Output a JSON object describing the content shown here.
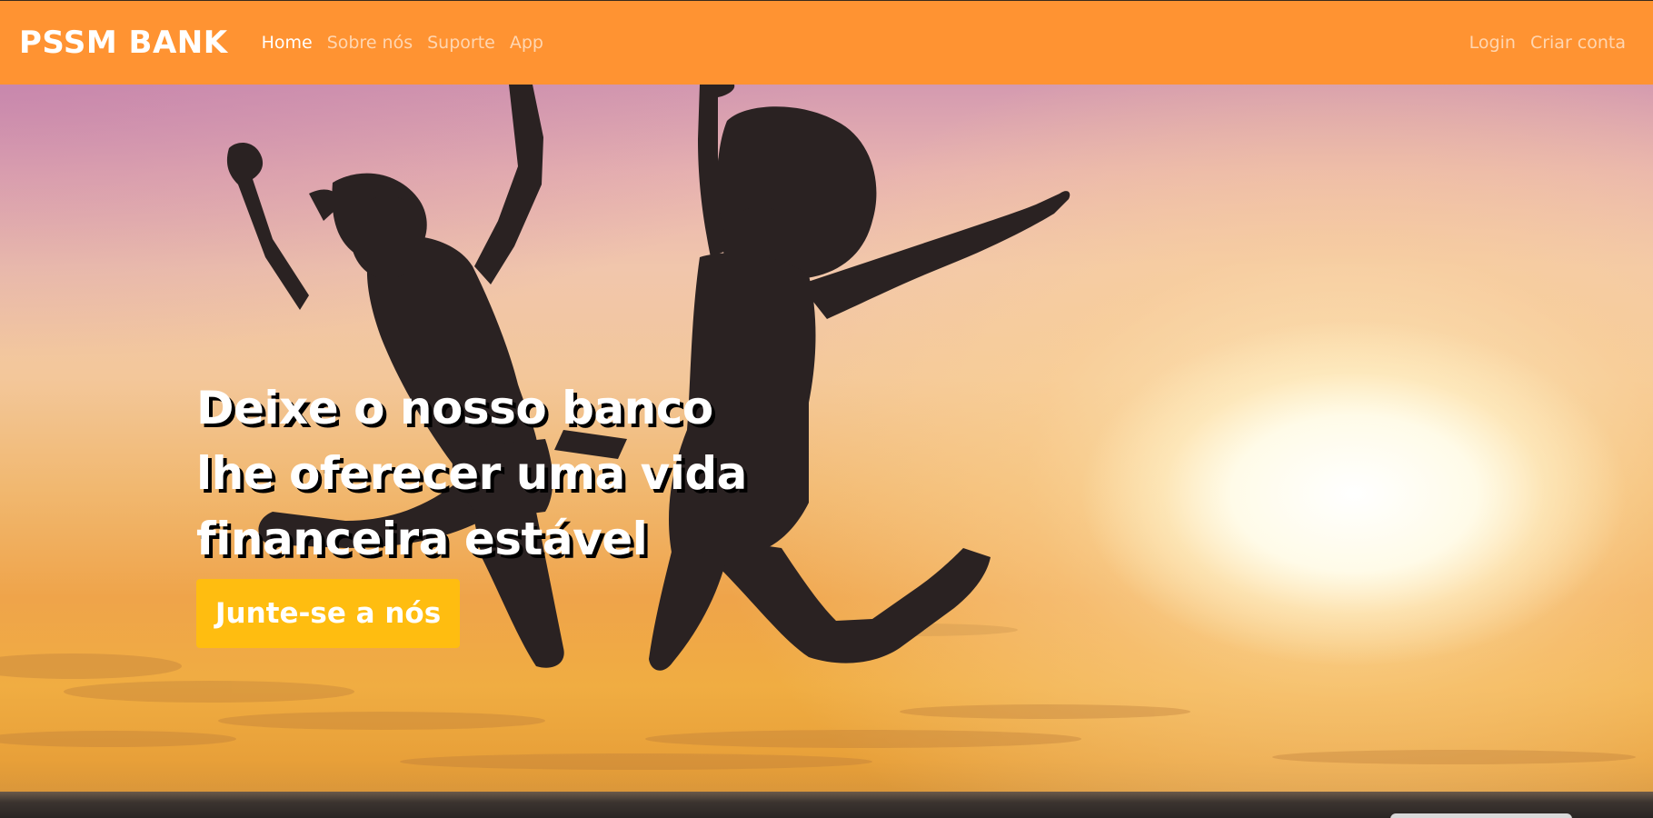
{
  "navbar": {
    "brand": "PSSM BANK",
    "left_links": [
      {
        "label": "Home",
        "active": true
      },
      {
        "label": "Sobre nós",
        "active": false
      },
      {
        "label": "Suporte",
        "active": false
      },
      {
        "label": "App",
        "active": false
      }
    ],
    "right_links": [
      {
        "label": "Login"
      },
      {
        "label": "Criar conta"
      }
    ],
    "background_color": "#ff9332"
  },
  "hero": {
    "title_lines": [
      "Deixe o nosso banco",
      "lhe oferecer uma vida",
      "financeira estável"
    ],
    "cta_label": "Junte-se a nós",
    "cta_color": "#ffbd10"
  }
}
